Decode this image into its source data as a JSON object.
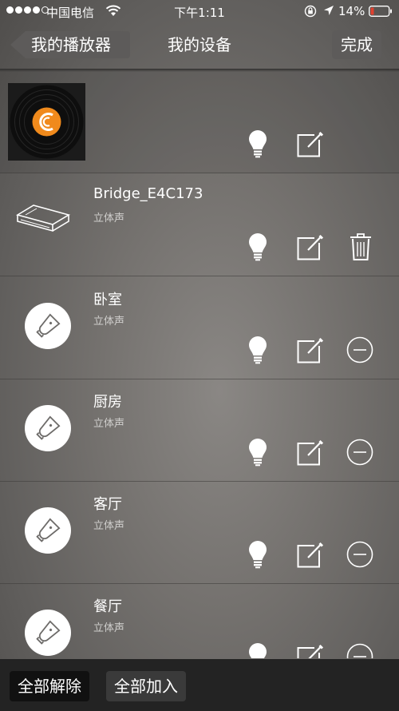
{
  "status": {
    "carrier": "中国电信",
    "time": "下午1:11",
    "battery": "14%"
  },
  "nav": {
    "back_label": "我的播放器",
    "title": "我的设备",
    "done_label": "完成"
  },
  "devices": [
    {
      "name": "",
      "subtitle": "",
      "icon": "record-disc-icon",
      "actions": [
        "bulb-icon",
        "edit-icon"
      ]
    },
    {
      "name": "Bridge_E4C173",
      "subtitle": "立体声",
      "icon": "router-icon",
      "actions": [
        "bulb-icon",
        "edit-icon",
        "trash-icon"
      ]
    },
    {
      "name": "卧室",
      "subtitle": "立体声",
      "icon": "speaker-bulb-icon",
      "actions": [
        "bulb-icon",
        "edit-icon",
        "remove-icon"
      ]
    },
    {
      "name": "厨房",
      "subtitle": "立体声",
      "icon": "speaker-bulb-icon",
      "actions": [
        "bulb-icon",
        "edit-icon",
        "remove-icon"
      ]
    },
    {
      "name": "客厅",
      "subtitle": "立体声",
      "icon": "speaker-bulb-icon",
      "actions": [
        "bulb-icon",
        "edit-icon",
        "remove-icon"
      ]
    },
    {
      "name": "餐厅",
      "subtitle": "立体声",
      "icon": "speaker-bulb-icon",
      "actions": [
        "bulb-icon",
        "edit-icon",
        "remove-icon"
      ]
    }
  ],
  "bottom": {
    "release_all": "全部解除",
    "add_all": "全部加入"
  },
  "colors": {
    "record_label": "#f08a1c",
    "nav_button_bg": "#5d5b5a",
    "bottom_bar_bg": "#232323"
  }
}
